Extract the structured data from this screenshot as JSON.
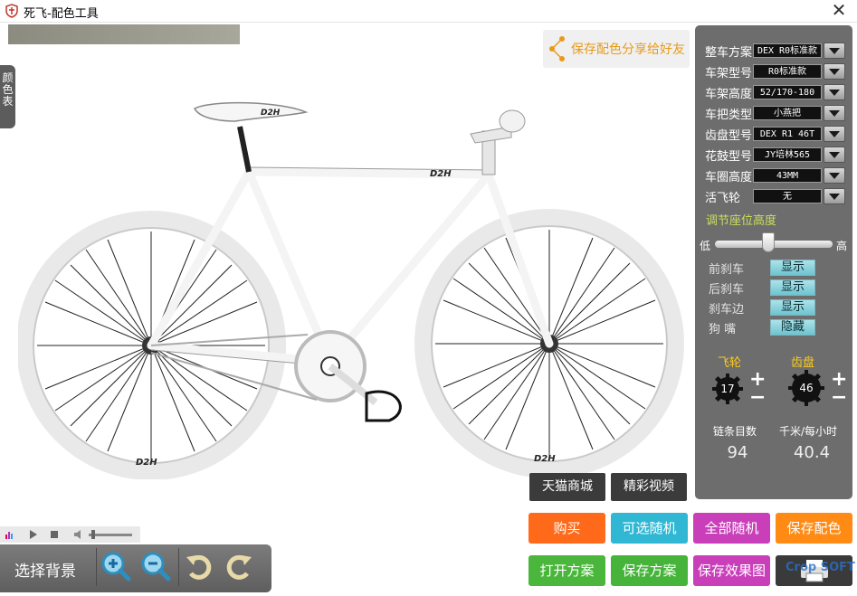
{
  "window": {
    "title": "死飞-配色工具",
    "close_label": "✕"
  },
  "side_tab": {
    "label": "颜色表"
  },
  "share": {
    "label": "保存配色分享给好友"
  },
  "options": [
    {
      "label": "整车方案",
      "value": "DEX R0标准款"
    },
    {
      "label": "车架型号",
      "value": "R0标准款"
    },
    {
      "label": "车架高度",
      "value": "52/170-180"
    },
    {
      "label": "车把类型",
      "value": "小燕把"
    },
    {
      "label": "齿盘型号",
      "value": "DEX R1 46T"
    },
    {
      "label": "花鼓型号",
      "value": "JY培林565"
    },
    {
      "label": "车圈高度",
      "value": "43MM"
    },
    {
      "label": "活飞轮",
      "value": "无"
    }
  ],
  "seat": {
    "title": "调节座位高度",
    "low": "低",
    "high": "高",
    "level": 0.45
  },
  "toggles": [
    {
      "label": "前刹车",
      "value": "显示"
    },
    {
      "label": "后刹车",
      "value": "显示"
    },
    {
      "label": "刹车边",
      "value": "显示"
    },
    {
      "label": "狗 嘴",
      "value": "隐藏"
    }
  ],
  "gearing": {
    "cog_label": "飞轮",
    "chainring_label": "齿盘",
    "cog_value": "17",
    "chainring_value": "46",
    "plus": "+",
    "minus": "−",
    "chain_links_label": "链条目数",
    "speed_label": "千米/每小时",
    "chain_links": "94",
    "speed": "40.4"
  },
  "bike_brand": "D2H",
  "media_buttons": [
    "tmall",
    "videos"
  ],
  "dark_buttons": {
    "tmall": "天猫商城",
    "videos": "精彩视频"
  },
  "action_buttons": {
    "buy": "购买",
    "optional_random": "可选随机",
    "all_random": "全部随机",
    "save_color": "保存配色",
    "open_plan": "打开方案",
    "save_plan": "保存方案",
    "save_image": "保存效果图",
    "print": "打印"
  },
  "colors": {
    "buy": "#ff6a1a",
    "optional_random": "#2fb7d3",
    "all_random": "#c93fb9",
    "save_color": "#ff8a14",
    "open_plan": "#4ab63c",
    "save_plan": "#46b33a",
    "save_image": "#c93fb9",
    "print": "#3a3a3a",
    "panel": "#6d6d6d"
  },
  "toolbar": {
    "bg_label": "选择背景"
  },
  "watermark": "Crop SOFT"
}
